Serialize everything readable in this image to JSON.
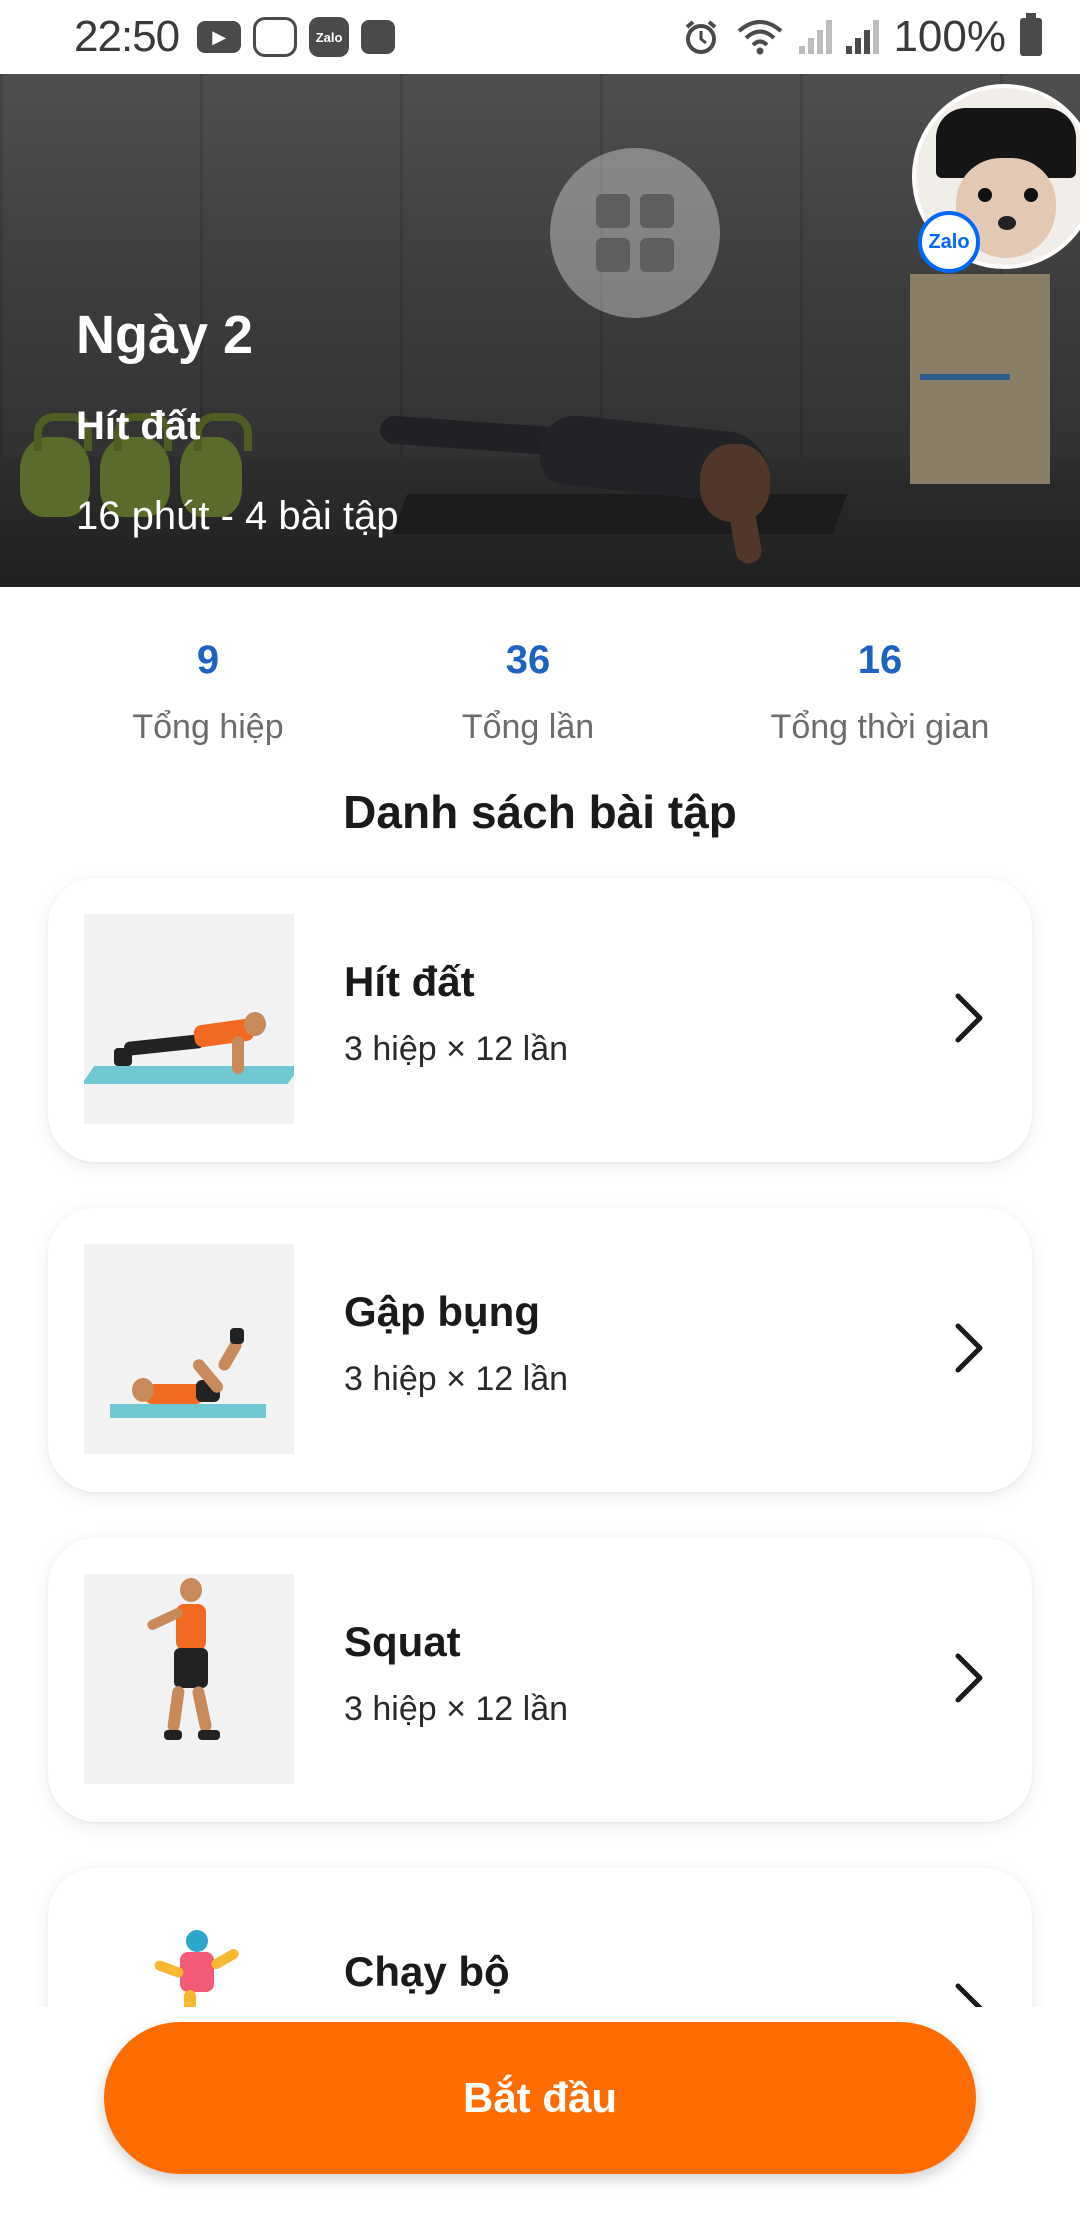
{
  "status_bar": {
    "time": "22:50",
    "battery_text": "100%",
    "left_icons": [
      "youtube-icon",
      "cat-app-icon",
      "zalo-icon",
      "game-icon"
    ],
    "right_icons": [
      "alarm-icon",
      "wifi-icon",
      "signal-icon",
      "signal-icon",
      "battery-icon"
    ],
    "zalo_icon_text": "Zalo"
  },
  "hero": {
    "title": "Ngày 2",
    "subtitle": "Hít đất",
    "meta": "16 phút - 4 bài tập",
    "grid_button_icon": "grid-icon",
    "avatar_badge": "Zalo"
  },
  "stats": [
    {
      "value": "9",
      "label": "Tổng hiệp"
    },
    {
      "value": "36",
      "label": "Tổng lần"
    },
    {
      "value": "16",
      "label": "Tổng thời gian"
    }
  ],
  "section_title": "Danh sách bài tập",
  "exercises": [
    {
      "name": "Hít đất",
      "detail": "3 hiệp × 12 lần",
      "icon": "pushup-illustration"
    },
    {
      "name": "Gập bụng",
      "detail": "3 hiệp × 12 lần",
      "icon": "crunch-illustration"
    },
    {
      "name": "Squat",
      "detail": "3 hiệp × 12 lần",
      "icon": "squat-illustration"
    },
    {
      "name": "Chạy bộ",
      "detail": "",
      "icon": "running-illustration"
    }
  ],
  "start_button": "Bắt đầu",
  "colors": {
    "accent_orange": "#ff6d00",
    "stat_blue": "#1e63c4",
    "zalo_blue": "#0068ff"
  }
}
